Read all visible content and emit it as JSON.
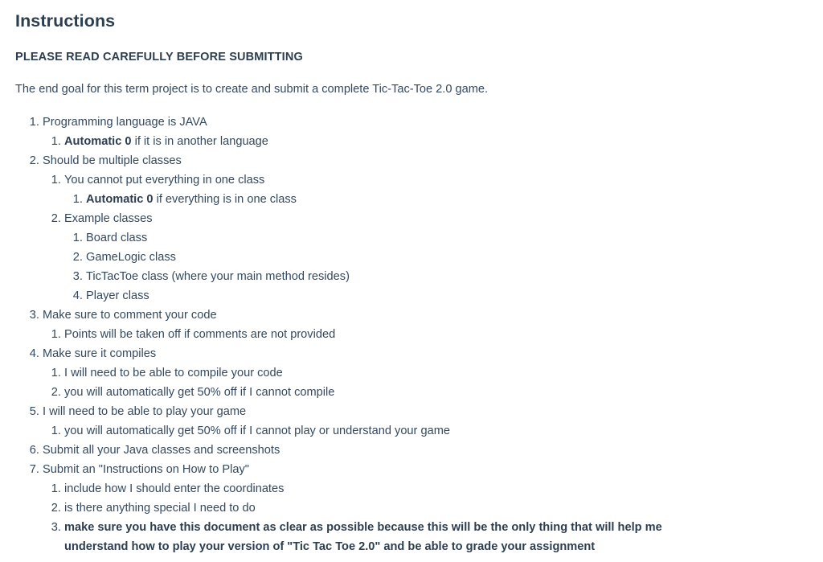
{
  "document": {
    "title": "Instructions",
    "warning": "PLEASE READ CAREFULLY BEFORE SUBMITTING",
    "intro": "The end goal for this term project is to create and submit a complete Tic-Tac-Toe 2.0 game.",
    "items": [
      {
        "text": "Programming language is JAVA",
        "children": [
          {
            "bold_prefix": "Automatic 0",
            "text": " if it is in another language"
          }
        ]
      },
      {
        "text": "Should be multiple classes",
        "children": [
          {
            "text": "You cannot put everything in one class",
            "children": [
              {
                "bold_prefix": "Automatic 0",
                "text": " if everything is in one class"
              }
            ]
          },
          {
            "text": "Example classes",
            "children": [
              {
                "text": "Board class"
              },
              {
                "text": "GameLogic class"
              },
              {
                "text": "TicTacToe class (where your main method resides)"
              },
              {
                "text": "Player class"
              }
            ]
          }
        ]
      },
      {
        "text": "Make sure to comment your code",
        "children": [
          {
            "text": "Points will be taken off if comments are not provided"
          }
        ]
      },
      {
        "text": "Make sure it compiles",
        "children": [
          {
            "text": "I will need to be able to compile your code"
          },
          {
            "text": "you will automatically get 50% off if I cannot compile"
          }
        ]
      },
      {
        "text": "I will need to be able to play your game",
        "children": [
          {
            "text": "you will automatically get 50% off if I cannot play or understand your game"
          }
        ]
      },
      {
        "text": "Submit all your Java classes and screenshots"
      },
      {
        "text": "Submit an \"Instructions on How to Play\"",
        "children": [
          {
            "text": "include how I should enter the coordinates"
          },
          {
            "text": "is there anything special I need to do"
          },
          {
            "bold": true,
            "text": "make sure you have this document as clear as possible because this will be the only thing that will help me understand how to play your version of \"Tic Tac Toe 2.0\" and be able to grade your assignment"
          }
        ]
      }
    ]
  },
  "colors": {
    "background": "#ffffff",
    "heading": "#2c3e50",
    "body_text": "#34495e"
  }
}
